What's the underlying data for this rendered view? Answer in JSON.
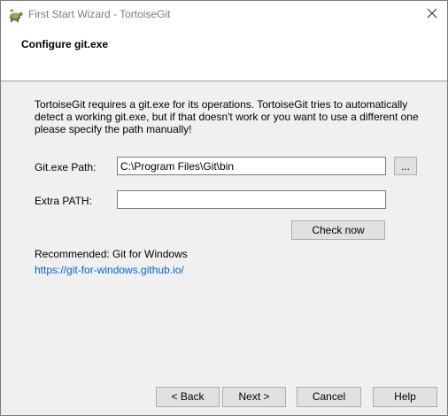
{
  "window": {
    "title": "First Start Wizard - TortoiseGit",
    "app_icon": "tortoisegit-icon",
    "close_icon": "close-icon"
  },
  "header": {
    "title": "Configure git.exe"
  },
  "body": {
    "description": "TortoiseGit requires a git.exe for its operations. TortoiseGit tries to automatically detect a working git.exe, but if that doesn't work or you want to use a different one please specify the path manually!",
    "git_path_label": "Git.exe Path:",
    "git_path_value": "C:\\Program Files\\Git\\bin",
    "browse_label": "...",
    "extra_path_label": "Extra PATH:",
    "extra_path_value": "",
    "check_now_label": "Check now",
    "recommended_text": "Recommended: Git for Windows",
    "recommended_link": "https://git-for-windows.github.io/"
  },
  "footer": {
    "back_label": "< Back",
    "next_label": "Next >",
    "cancel_label": "Cancel",
    "help_label": "Help"
  }
}
